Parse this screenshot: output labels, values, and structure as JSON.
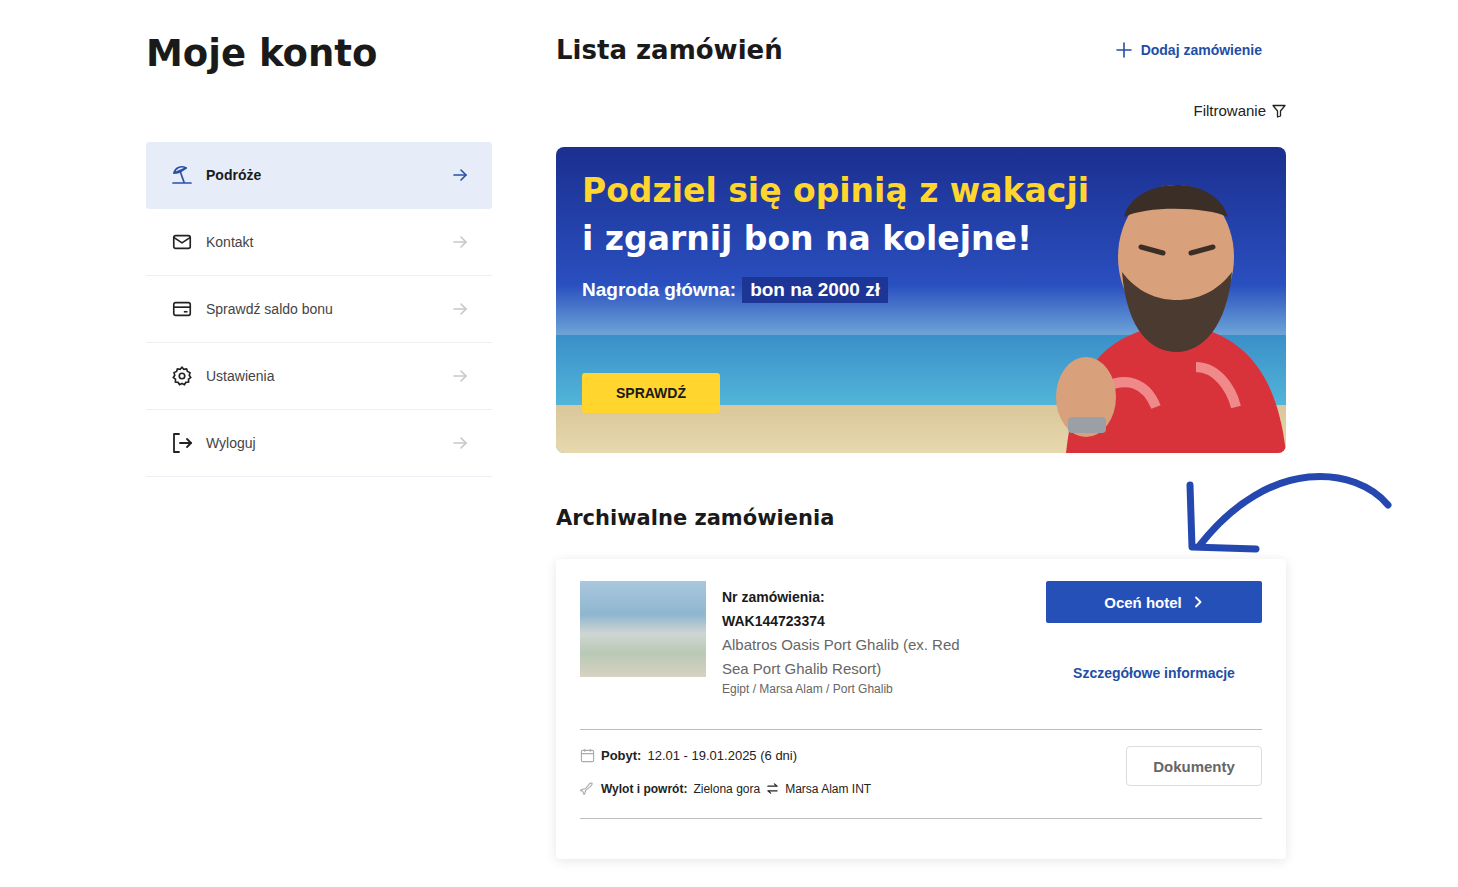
{
  "account_title": "Moje konto",
  "sidebar": {
    "items": [
      {
        "label": "Podróże",
        "selected": true
      },
      {
        "label": "Kontakt",
        "selected": false
      },
      {
        "label": "Sprawdź saldo bonu",
        "selected": false
      },
      {
        "label": "Ustawienia",
        "selected": false
      },
      {
        "label": "Wyloguj",
        "selected": false
      }
    ]
  },
  "orders_title": "Lista zamówień",
  "add_order": {
    "label": "Dodaj zamówienie"
  },
  "filter": {
    "label": "Filtrowanie"
  },
  "banner": {
    "title_lines": [
      "Podziel się opinią z wakacji",
      "i zgarnij bon na kolejne!"
    ],
    "prize_label": "Nagroda główna:",
    "prize_value": "bon na 2000 zł",
    "button": "SPRAWDŹ"
  },
  "archive": {
    "title": "Archiwalne zamówienia",
    "orders": [
      {
        "number_label": "Nr zamówienia:",
        "number": "WAK144723374",
        "hotel": "Albatros Oasis Port Ghalib (ex. Red Sea Port Ghalib Resort)",
        "location": "Egipt / Marsa Alam / Port Ghalib",
        "rate_button": "Oceń hotel",
        "details_link": "Szczegółowe informacje",
        "stay_label": "Pobyt:",
        "stay": "12.01 - 19.01.2025 (6 dni)",
        "flight_label": "Wylot i powrót:",
        "flight_from": "Zielona gora",
        "flight_to": "Marsa Alam INT",
        "documents_button": "Dokumenty"
      }
    ]
  }
}
